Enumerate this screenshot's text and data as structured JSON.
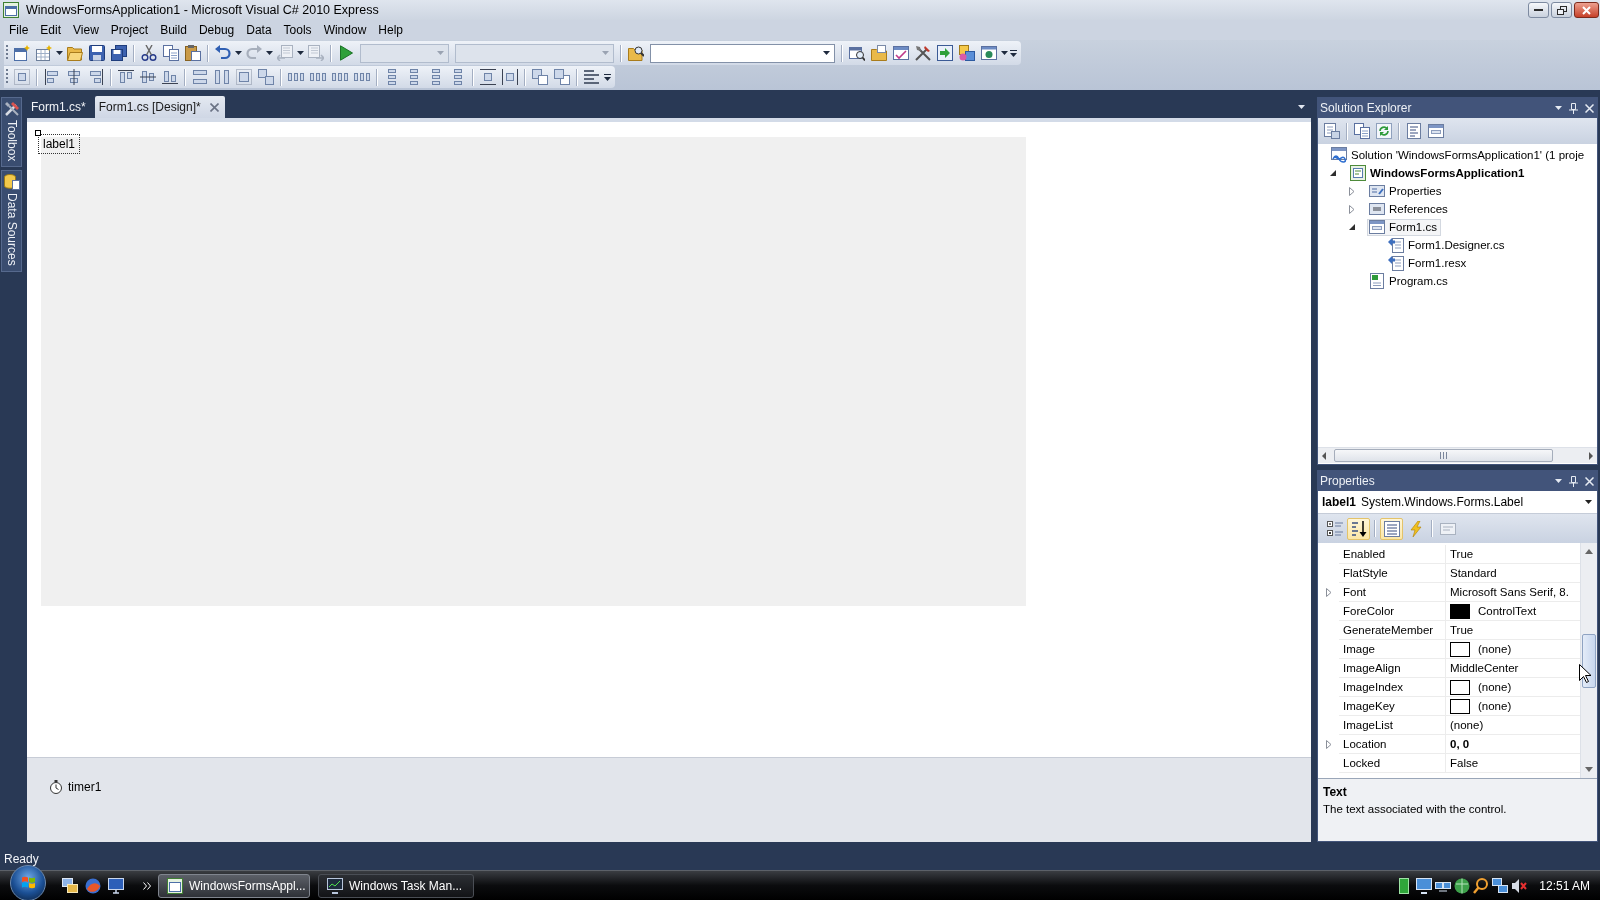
{
  "window": {
    "title": "WindowsFormsApplication1 - Microsoft Visual C# 2010 Express"
  },
  "menu": [
    {
      "label": "File"
    },
    {
      "label": "Edit"
    },
    {
      "label": "View"
    },
    {
      "label": "Project"
    },
    {
      "label": "Build"
    },
    {
      "label": "Debug"
    },
    {
      "label": "Data"
    },
    {
      "label": "Tools"
    },
    {
      "label": "Window"
    },
    {
      "label": "Help"
    }
  ],
  "toolbar": {
    "combos": [
      {
        "disabled": true
      },
      {
        "disabled": true
      },
      {
        "disabled": false
      }
    ]
  },
  "side_tabs": [
    {
      "label": "Toolbox",
      "kind": "toolbox"
    },
    {
      "label": "Data Sources",
      "kind": "data"
    }
  ],
  "document_tabs": [
    {
      "label": "Form1.cs*",
      "selected": false
    },
    {
      "label": "Form1.cs [Design]*",
      "selected": true
    }
  ],
  "designer": {
    "controls": [
      {
        "text": "label1",
        "selected": true
      }
    ],
    "components": [
      {
        "name": "timer1"
      }
    ]
  },
  "solution_explorer": {
    "title": "Solution Explorer",
    "tree": [
      {
        "label": "Solution 'WindowsFormsApplication1' (1 proje",
        "kind": "solution",
        "selected": false,
        "startup": false,
        "children": [
          {
            "label": "WindowsFormsApplication1",
            "kind": "project",
            "selected": false,
            "startup": true,
            "expanded": true,
            "children": [
              {
                "label": "Properties",
                "kind": "properties",
                "selected": false,
                "startup": false,
                "expanded": false
              },
              {
                "label": "References",
                "kind": "references",
                "selected": false,
                "startup": false,
                "expanded": false
              },
              {
                "label": "Form1.cs",
                "kind": "form",
                "selected": true,
                "startup": false,
                "expanded": true,
                "children": [
                  {
                    "label": "Form1.Designer.cs",
                    "kind": "dependent",
                    "selected": false,
                    "startup": false
                  },
                  {
                    "label": "Form1.resx",
                    "kind": "dependent",
                    "selected": false,
                    "startup": false
                  }
                ]
              },
              {
                "label": "Program.cs",
                "kind": "code",
                "selected": false,
                "startup": false
              }
            ]
          }
        ]
      }
    ]
  },
  "properties": {
    "title": "Properties",
    "object_name": "label1",
    "object_type": "System.Windows.Forms.Label",
    "sort_buttons": [
      {
        "selected": false
      },
      {
        "selected": true
      }
    ],
    "view_buttons": [
      {
        "selected": true
      },
      {
        "selected": false
      }
    ],
    "pages_button": {
      "disabled": true
    },
    "rows": [
      {
        "name": "Enabled",
        "value": "True",
        "kind": "text",
        "expandable": false,
        "modified": false
      },
      {
        "name": "FlatStyle",
        "value": "Standard",
        "kind": "text",
        "expandable": false,
        "modified": false
      },
      {
        "name": "Font",
        "value": "Microsoft Sans Serif, 8.",
        "kind": "text",
        "expandable": true,
        "modified": false
      },
      {
        "name": "ForeColor",
        "value": "ControlText",
        "kind": "swatch",
        "color": "#000000",
        "expandable": false,
        "modified": false
      },
      {
        "name": "GenerateMember",
        "value": "True",
        "kind": "text",
        "expandable": false,
        "modified": false
      },
      {
        "name": "Image",
        "value": "(none)",
        "kind": "swatch",
        "color": "#ffffff",
        "expandable": false,
        "modified": false
      },
      {
        "name": "ImageAlign",
        "value": "MiddleCenter",
        "kind": "text",
        "expandable": false,
        "modified": false
      },
      {
        "name": "ImageIndex",
        "value": "(none)",
        "kind": "swatch",
        "color": "#ffffff",
        "expandable": false,
        "modified": false
      },
      {
        "name": "ImageKey",
        "value": "(none)",
        "kind": "swatch",
        "color": "#ffffff",
        "expandable": false,
        "modified": false
      },
      {
        "name": "ImageList",
        "value": "(none)",
        "kind": "text",
        "expandable": false,
        "modified": false
      },
      {
        "name": "Location",
        "value": "0, 0",
        "kind": "text",
        "expandable": true,
        "modified": true
      },
      {
        "name": "Locked",
        "value": "False",
        "kind": "text",
        "expandable": false,
        "modified": false
      }
    ],
    "description": {
      "title": "Text",
      "text": "The text associated with the control."
    }
  },
  "status_bar": {
    "text": "Ready"
  },
  "taskbar": {
    "tasks": [
      {
        "label": "WindowsFormsAppl...",
        "selected": true
      },
      {
        "label": "Windows Task Man...",
        "selected": false
      }
    ],
    "clock": "12:51 AM"
  }
}
